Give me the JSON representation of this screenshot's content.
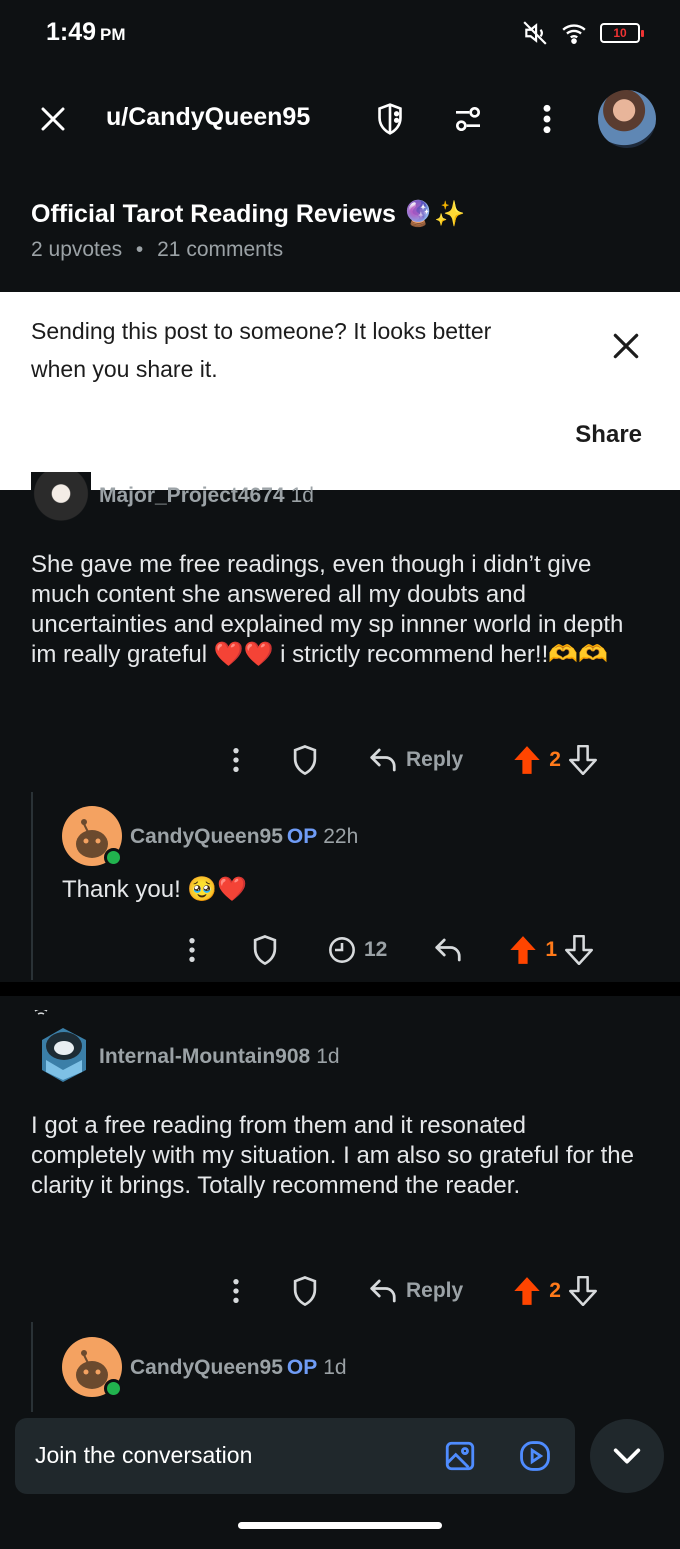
{
  "status_bar": {
    "time": "1:49",
    "ampm": "PM",
    "battery": "10"
  },
  "header": {
    "username": "u/CandyQueen95"
  },
  "post": {
    "title": "Official Tarot Reading Reviews 🔮✨",
    "upvotes": "2 upvotes",
    "comments": "21 comments",
    "separator": "•"
  },
  "share_banner": {
    "message": "Sending this post to someone? It looks better when you share it.",
    "share_label": "Share"
  },
  "comments": [
    {
      "author": "Major_Project4674",
      "age": "1d",
      "body": "She gave me free readings, even though i didn’t give much content she answered all my doubts and uncertainties and explained my sp innner world in depth im really grateful ❤️❤️ i strictly recommend her!!🫶🫶",
      "reply_label": "Reply",
      "votes": "2",
      "reply": {
        "author": "CandyQueen95",
        "op": "OP",
        "age": "22h",
        "body": "Thank you! 🥹❤️",
        "award_count": "12",
        "votes": "1"
      }
    },
    {
      "author": "Internal-Mountain908",
      "age": "1d",
      "body": "I got a free reading from them and it resonated completely with my situation. I am also so grateful for the clarity it brings. Totally recommend the reader.",
      "reply_label": "Reply",
      "votes": "2",
      "reply": {
        "author": "CandyQueen95",
        "op": "OP",
        "age": "1d"
      }
    }
  ],
  "composer": {
    "placeholder": "Join the conversation"
  },
  "colors": {
    "upvote": "#ff4500",
    "op": "#6f9cf6",
    "online": "#21b34e",
    "composer_icon": "#4f8cff"
  }
}
